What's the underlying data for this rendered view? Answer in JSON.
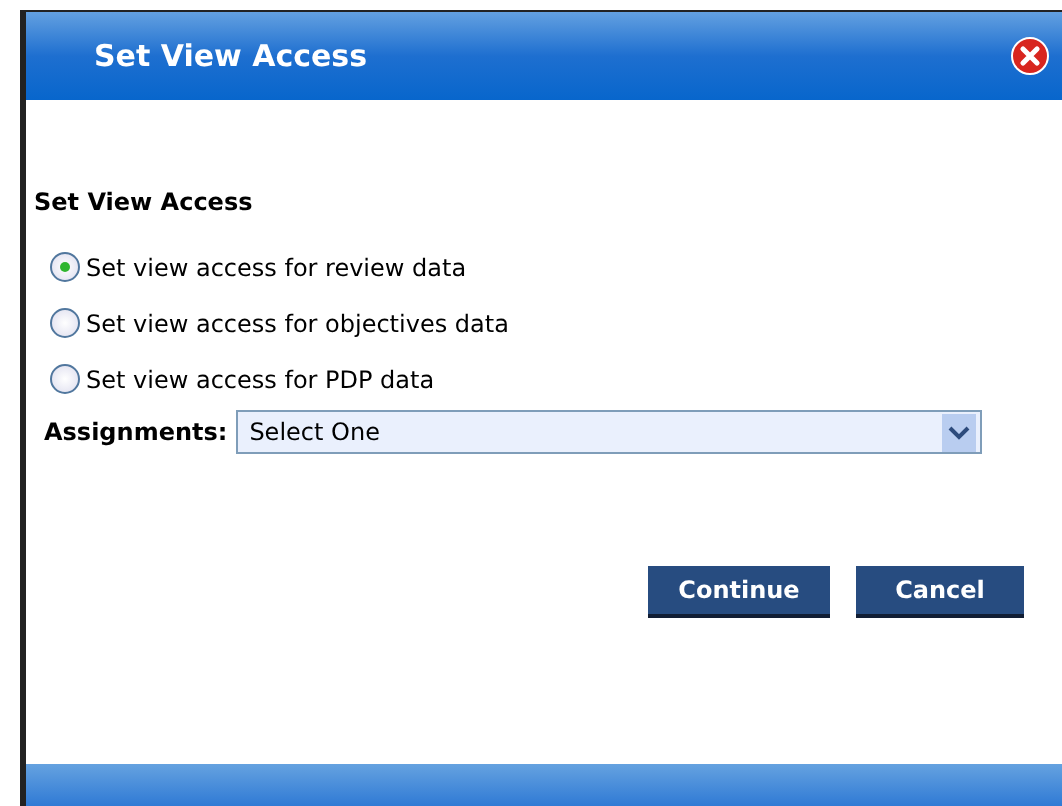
{
  "window": {
    "title": "Set View Access"
  },
  "heading": "Set View Access",
  "options": [
    {
      "label": "Set view access for review data",
      "selected": true
    },
    {
      "label": "Set view access for objectives data",
      "selected": false
    },
    {
      "label": "Set view access for PDP data",
      "selected": false
    }
  ],
  "assignments": {
    "label": "Assignments:",
    "value": "Select One"
  },
  "buttons": [
    "Continue",
    "Cancel"
  ]
}
